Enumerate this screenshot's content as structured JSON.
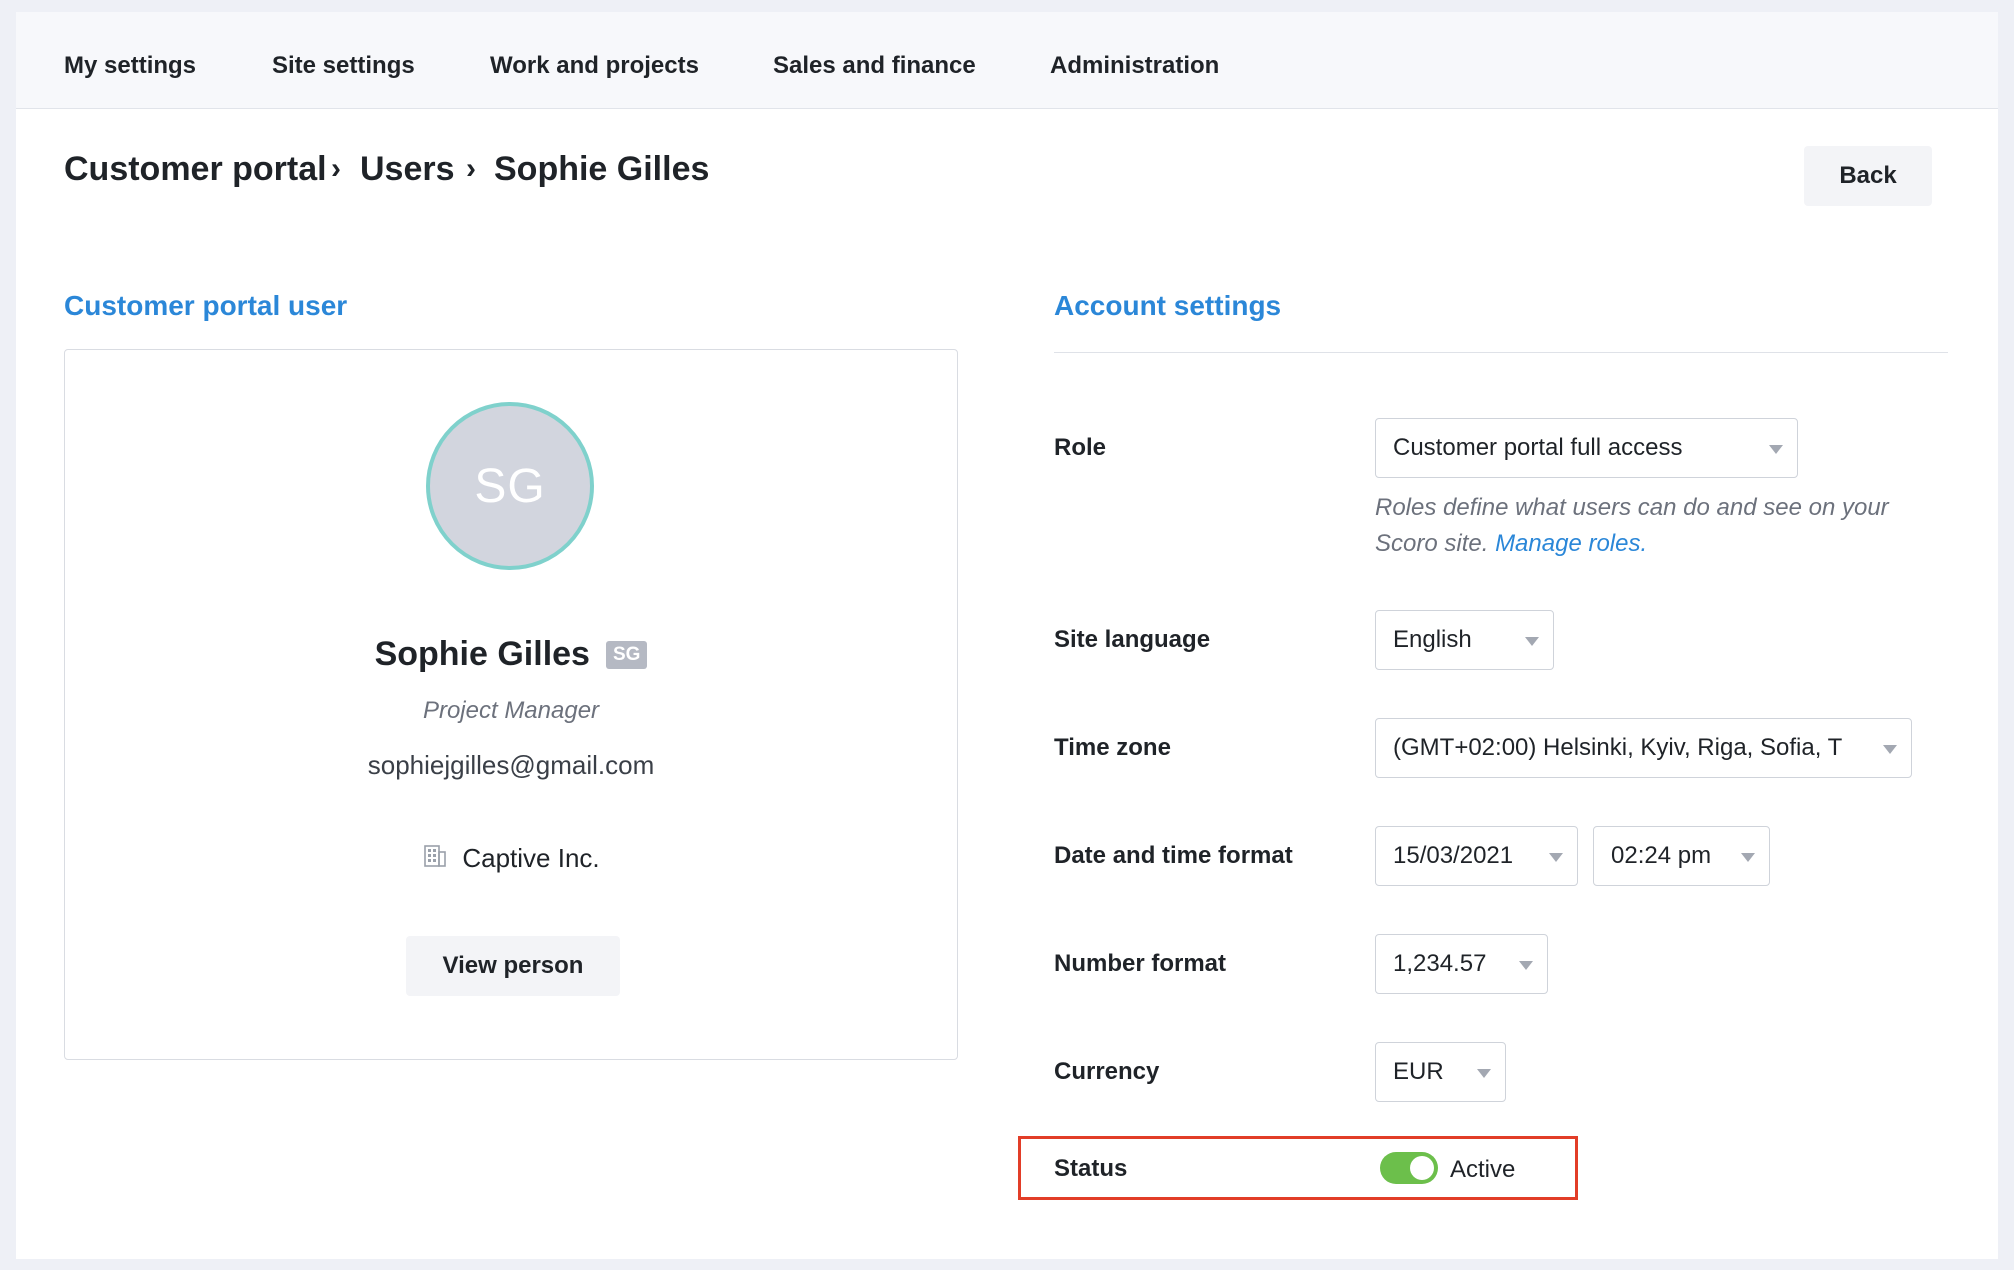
{
  "nav": {
    "items": [
      {
        "label": "My settings"
      },
      {
        "label": "Site settings"
      },
      {
        "label": "Work and projects"
      },
      {
        "label": "Sales and finance"
      },
      {
        "label": "Administration"
      }
    ]
  },
  "breadcrumb": {
    "items": [
      "Customer portal",
      "Users",
      "Sophie Gilles"
    ],
    "separator": "›"
  },
  "back_button": {
    "label": "Back"
  },
  "profile": {
    "section_title": "Customer portal user",
    "avatar_initials": "SG",
    "name": "Sophie Gilles",
    "badge": "SG",
    "job_title": "Project Manager",
    "email": "sophiejgilles@gmail.com",
    "company_icon": "building-icon",
    "company": "Captive Inc.",
    "view_person_label": "View person"
  },
  "account": {
    "section_title": "Account settings",
    "role": {
      "label": "Role",
      "value": "Customer portal full access"
    },
    "role_help": {
      "text": "Roles define what users can do and see on your Scoro site.",
      "link": "Manage roles."
    },
    "language": {
      "label": "Site language",
      "value": "English"
    },
    "timezone": {
      "label": "Time zone",
      "value": "(GMT+02:00) Helsinki, Kyiv, Riga, Sofia, T"
    },
    "datetime": {
      "label": "Date and time format",
      "date_value": "15/03/2021",
      "time_value": "02:24 pm"
    },
    "number": {
      "label": "Number format",
      "value": "1,234.57"
    },
    "currency": {
      "label": "Currency",
      "value": "EUR"
    },
    "status": {
      "label": "Status",
      "value": "Active",
      "enabled": true
    }
  },
  "colors": {
    "accent": "#2b87d8",
    "toggle_on": "#6cbf4b",
    "highlight": "#e23d28",
    "avatar_ring": "#7fd1cc"
  }
}
